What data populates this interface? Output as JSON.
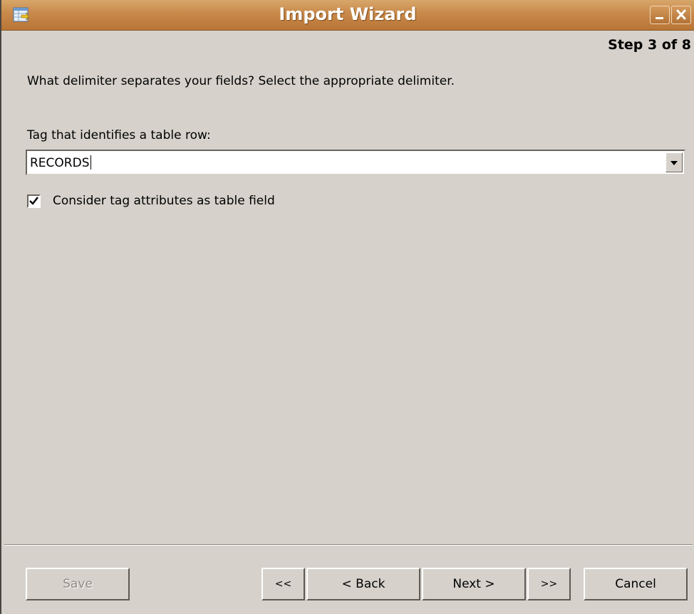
{
  "window": {
    "title": "Import Wizard",
    "icon": "table-import-icon",
    "controls": {
      "minimize": "minimize-icon",
      "close": "close-icon"
    }
  },
  "header": {
    "step": "Step 3 of 8"
  },
  "content": {
    "instruction": "What delimiter separates your fields? Select the appropriate delimiter.",
    "row_tag_label": "Tag that identifies a table row:",
    "row_tag_value": "RECORDS",
    "attributes_checkbox_label": "Consider tag attributes as table field",
    "attributes_checked": true
  },
  "buttons": {
    "save": "Save",
    "first": "<<",
    "back": "< Back",
    "next": "Next >",
    "last": ">>",
    "cancel": "Cancel"
  },
  "colors": {
    "titlebar": "#c8894a",
    "background": "#d6d2cb"
  }
}
